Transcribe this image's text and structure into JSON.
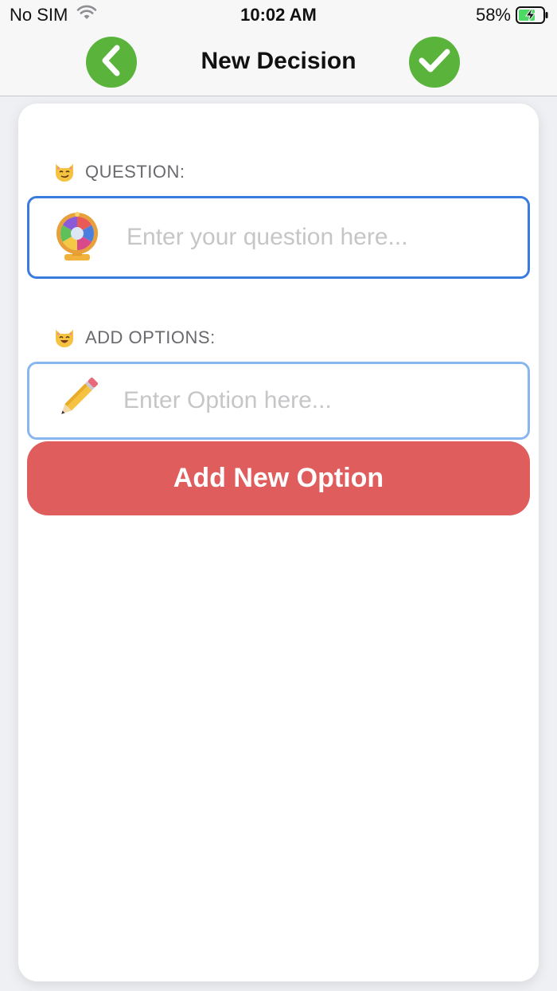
{
  "status_bar": {
    "carrier": "No SIM",
    "time": "10:02 AM",
    "battery_percent": "58%",
    "wifi_icon": "wifi-icon",
    "battery_icon": "battery-charging-icon"
  },
  "nav": {
    "title": "New Decision",
    "back_icon": "chevron-left-icon",
    "done_icon": "checkmark-icon",
    "accent_color": "#5ab43b"
  },
  "form": {
    "question_label": "QUESTION:",
    "question_label_icon": "cat-smirk-icon",
    "question_placeholder": "Enter your question here...",
    "question_value": "",
    "question_icon": "prize-wheel-icon",
    "options_label": "ADD OPTIONS:",
    "options_label_icon": "cat-smile-icon",
    "option_placeholder": "Enter Option here...",
    "option_value": "",
    "option_icon": "pencil-icon",
    "add_button_label": "Add New Option",
    "add_button_color": "#e05d5d",
    "focus_border_color": "#3a7be0"
  }
}
